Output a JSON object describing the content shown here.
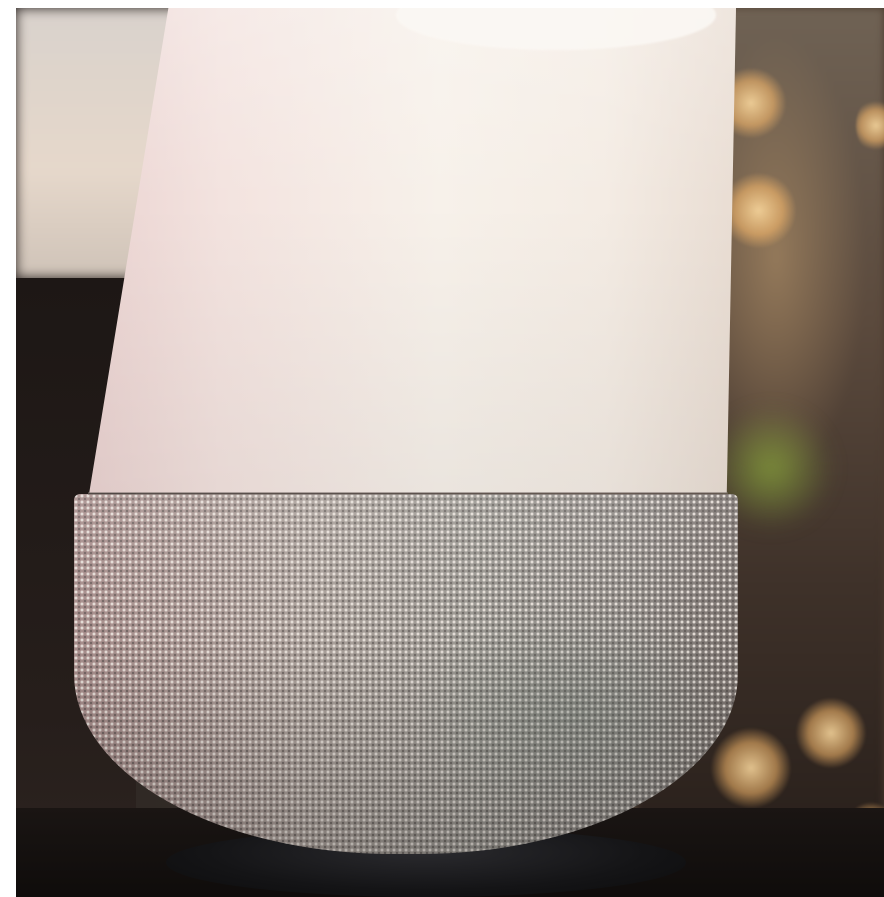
{
  "scene": {
    "subject": "smart-speaker",
    "colors": {
      "speaker_top": "#f4ece4",
      "speaker_fabric": "#9d948f",
      "speaker_base": "#141416",
      "background_dark": "#2b2523",
      "bokeh": "#ffd79a",
      "foliage": "#8caa3c"
    }
  }
}
